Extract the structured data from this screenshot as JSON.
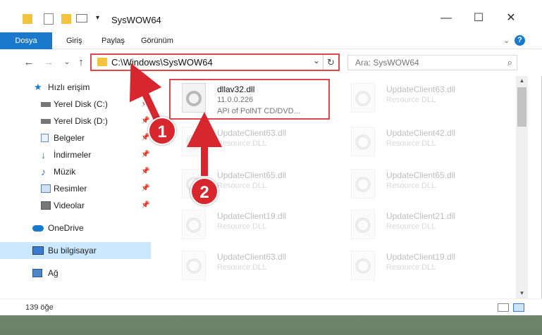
{
  "window": {
    "title": "SysWOW64",
    "controls": {
      "minimize": "—",
      "maximize": "☐",
      "close": "✕"
    }
  },
  "ribbon": {
    "tabs": [
      {
        "label": "Dosya",
        "active": true
      },
      {
        "label": "Giriş"
      },
      {
        "label": "Paylaş"
      },
      {
        "label": "Görünüm"
      }
    ],
    "expand": "⌄",
    "help": "?"
  },
  "address": {
    "path": "C:\\Windows\\SysWOW64",
    "dropdown": "⌄",
    "refresh": "↻"
  },
  "nav_buttons": {
    "back": "←",
    "forward": "→",
    "recent": "⌄",
    "up": "↑"
  },
  "search": {
    "placeholder": "Ara: SysWOW64",
    "icon": "⌕"
  },
  "sidebar": {
    "items": [
      {
        "label": "Hızlı erişim",
        "icon": "star-icon",
        "pinned": false
      },
      {
        "label": "Yerel Disk (C:)",
        "icon": "drive-icon",
        "pinned": true
      },
      {
        "label": "Yerel Disk (D:)",
        "icon": "drive-icon",
        "pinned": true
      },
      {
        "label": "Belgeler",
        "icon": "documents-icon",
        "pinned": true
      },
      {
        "label": "İndirmeler",
        "icon": "download-icon",
        "pinned": true
      },
      {
        "label": "Müzik",
        "icon": "music-icon",
        "pinned": true
      },
      {
        "label": "Resimler",
        "icon": "pictures-icon",
        "pinned": true
      },
      {
        "label": "Videolar",
        "icon": "videos-icon",
        "pinned": true
      },
      {
        "label": "OneDrive",
        "icon": "cloud-icon",
        "pinned": false
      },
      {
        "label": "Bu bilgisayar",
        "icon": "computer-icon",
        "pinned": false,
        "selected": true
      },
      {
        "label": "Ağ",
        "icon": "network-icon",
        "pinned": false
      }
    ],
    "pin_glyph": "📌"
  },
  "files": {
    "highlighted": {
      "name": "dllav32.dll",
      "version": "11.0.0.226",
      "desc": "API of PolNT CD/DVD..."
    },
    "ghosts": [
      {
        "name": "UpdateClient63.dll",
        "desc": "Resource DLL"
      },
      {
        "name": "UpdateClient63.dll",
        "desc": "Resource DLL"
      },
      {
        "name": "UpdateClient42.dll",
        "desc": "Resource DLL"
      },
      {
        "name": "UpdateClient65.dll",
        "desc": "Resource DLL"
      },
      {
        "name": "UpdateClient65.dll",
        "desc": "Resource DLL"
      },
      {
        "name": "UpdateClient19.dll",
        "desc": "Resource DLL"
      },
      {
        "name": "UpdateClient21.dll",
        "desc": "Resource DLL"
      },
      {
        "name": "UpdateClient63.dll",
        "desc": "Resource DLL"
      },
      {
        "name": "UpdateClient19.dll",
        "desc": "Resource DLL"
      }
    ]
  },
  "status": {
    "count": "139 öğe"
  },
  "annotations": {
    "step1": "1",
    "step2": "2"
  },
  "colors": {
    "accent": "#1979ca",
    "highlight": "#e0464c",
    "badge": "#d8262f"
  }
}
